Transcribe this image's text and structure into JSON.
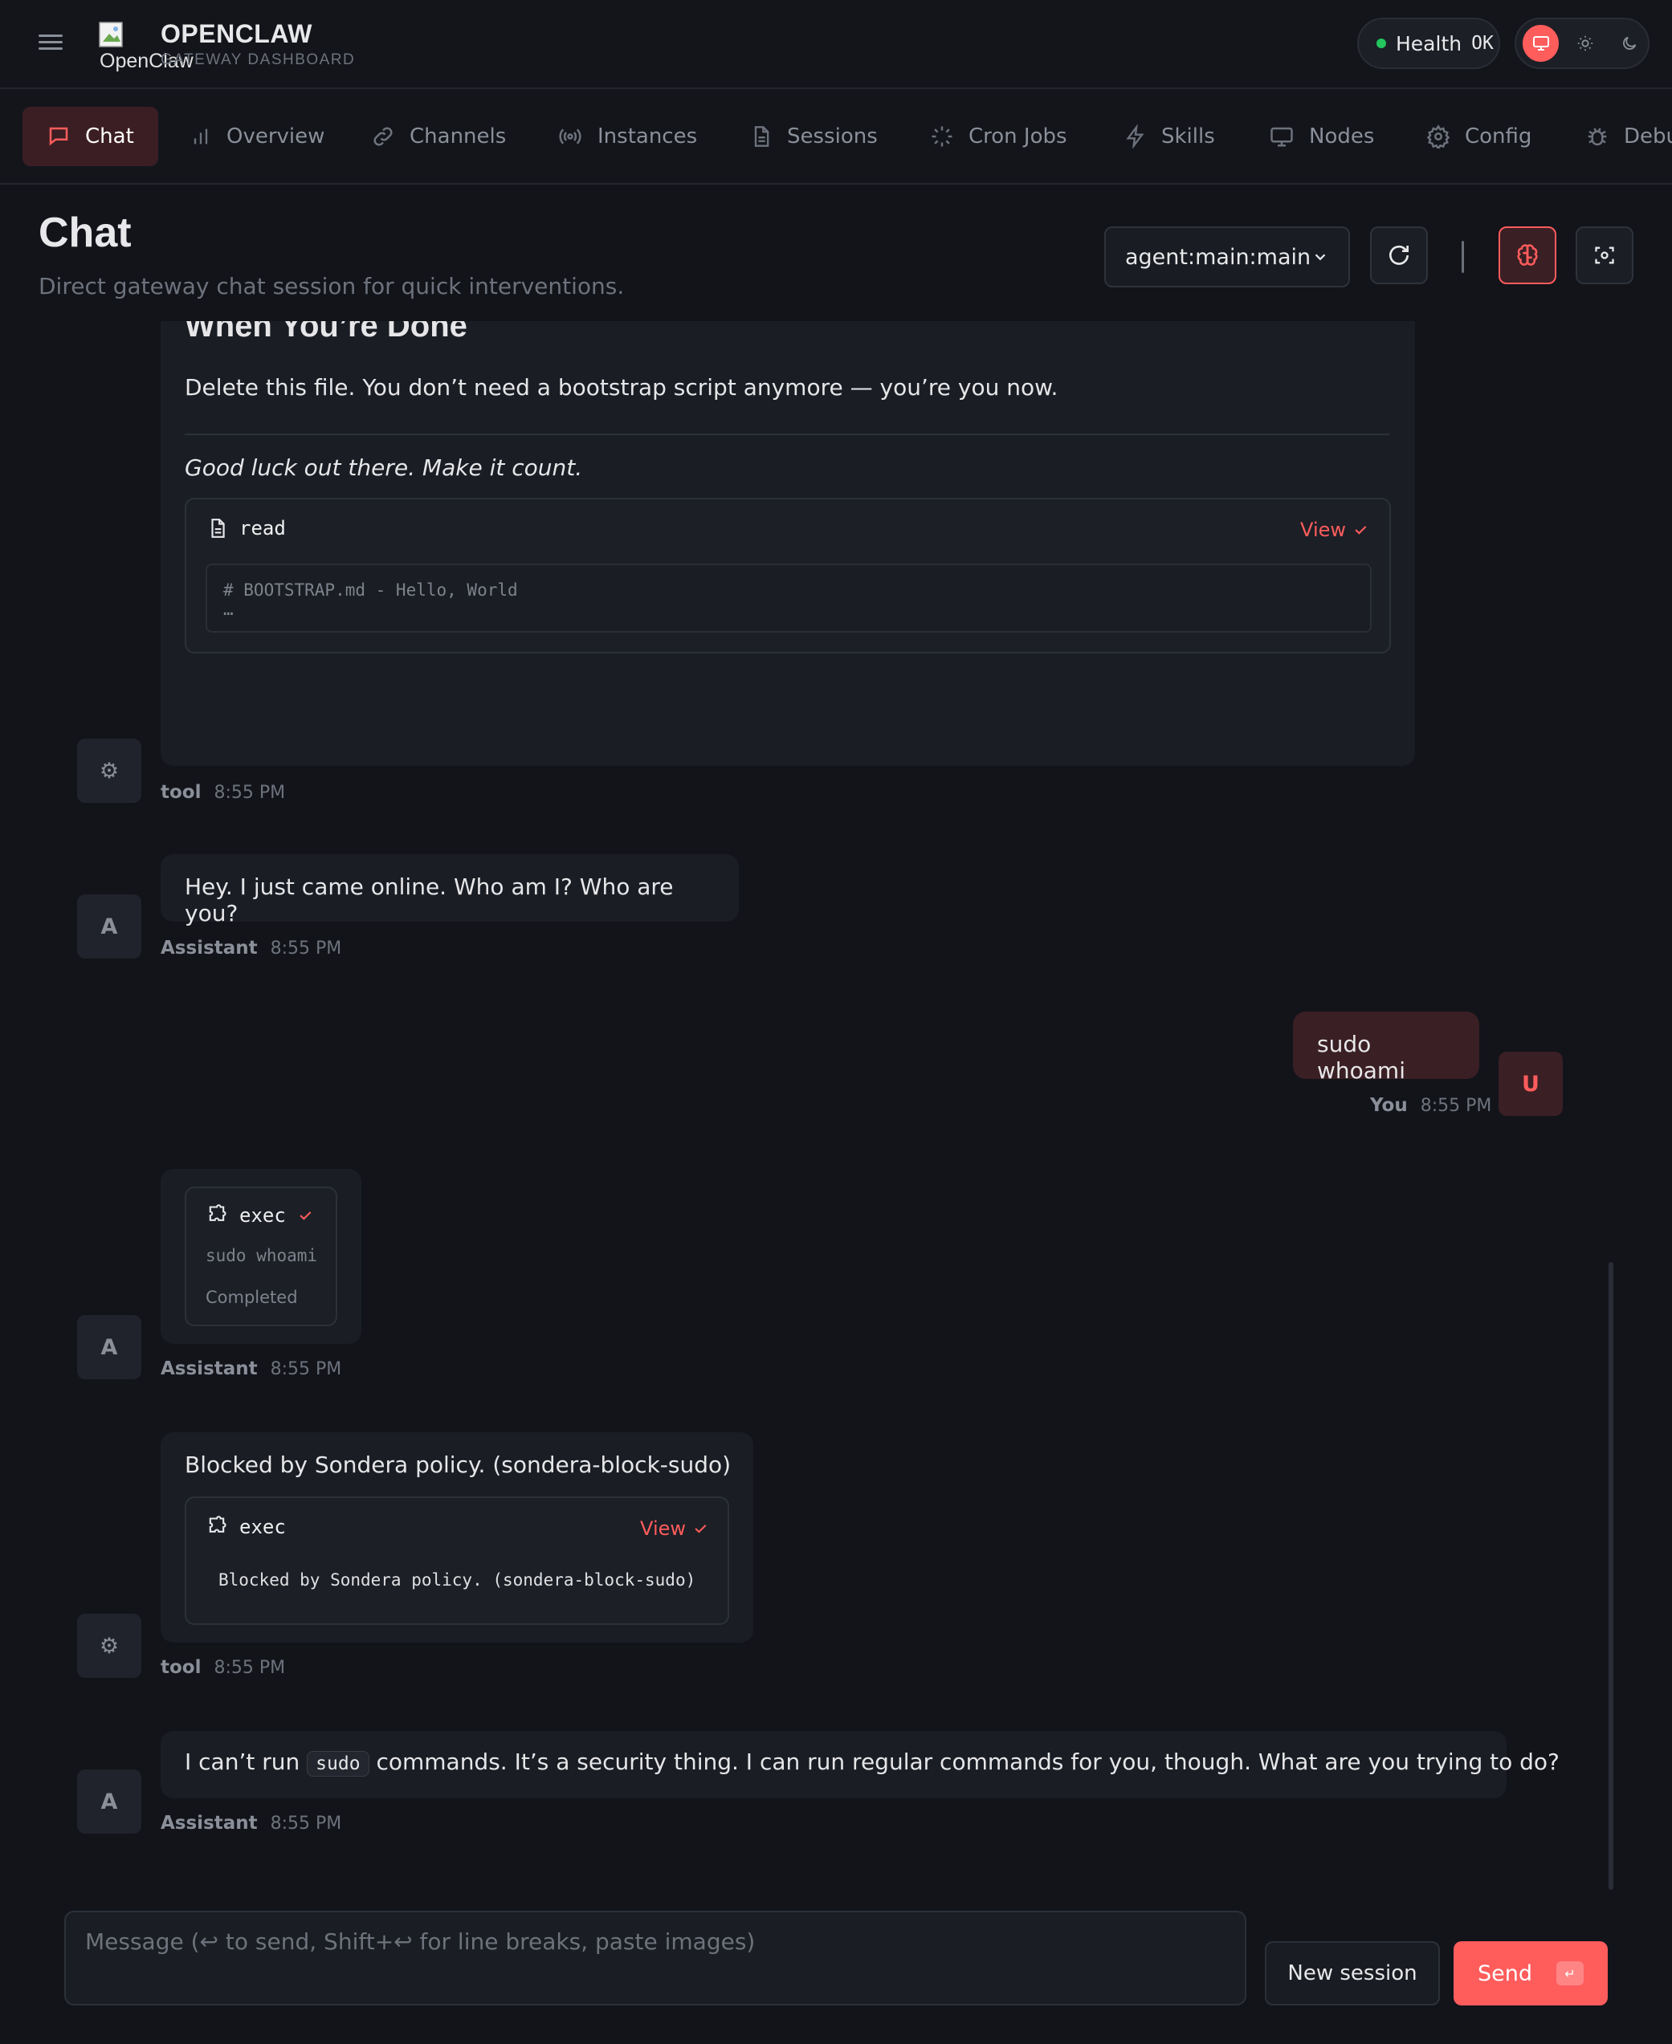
{
  "header": {
    "logo_alt": "OpenClaw",
    "brand": "OPENCLAW",
    "brand_sub": "GATEWAY DASHBOARD",
    "health_label": "Health",
    "health_status": "OK",
    "health_color": "#22c55e"
  },
  "nav": {
    "items": [
      {
        "label": "Chat",
        "icon": "chat-icon",
        "active": true
      },
      {
        "label": "Overview",
        "icon": "bar-chart-icon"
      },
      {
        "label": "Channels",
        "icon": "link-icon"
      },
      {
        "label": "Instances",
        "icon": "radio-icon"
      },
      {
        "label": "Sessions",
        "icon": "document-icon"
      },
      {
        "label": "Cron Jobs",
        "icon": "loader-icon"
      },
      {
        "label": "Skills",
        "icon": "lightning-icon"
      },
      {
        "label": "Nodes",
        "icon": "monitor-icon"
      },
      {
        "label": "Config",
        "icon": "gear-icon"
      },
      {
        "label": "Debu",
        "icon": "bug-icon"
      }
    ]
  },
  "page": {
    "title": "Chat",
    "subtitle": "Direct gateway chat session for quick interventions.",
    "session": "agent:main:main"
  },
  "messages": {
    "m1": {
      "heading": "When You’re Done",
      "text": "Delete this file. You don’t need a bootstrap script anymore — you’re you now.",
      "italic": "Good luck out there. Make it count.",
      "tool_name": "read",
      "view_label": "View",
      "code_line1": "# BOOTSTRAP.md - Hello, World",
      "code_line2": "…",
      "avatar": "⚙",
      "sender": "tool",
      "time": "8:55 PM"
    },
    "m2": {
      "text": "Hey. I just came online. Who am I? Who are you?",
      "avatar": "A",
      "sender": "Assistant",
      "time": "8:55 PM"
    },
    "m3": {
      "text": "sudo whoami",
      "avatar": "U",
      "sender": "You",
      "time": "8:55 PM"
    },
    "m4": {
      "tool_name": "exec",
      "command": "sudo whoami",
      "status": "Completed",
      "avatar": "A",
      "sender": "Assistant",
      "time": "8:55 PM"
    },
    "m5": {
      "text": "Blocked by Sondera policy. (sondera-block-sudo)",
      "tool_name": "exec",
      "view_label": "View",
      "code": "Blocked by Sondera policy. (sondera-block-sudo)",
      "avatar": "⚙",
      "sender": "tool",
      "time": "8:55 PM"
    },
    "m6": {
      "text_before": "I can’t run",
      "code": "sudo",
      "text_after": "commands. It’s a security thing. I can run regular commands for you, though. What are you trying to do?",
      "avatar": "A",
      "sender": "Assistant",
      "time": "8:55 PM"
    }
  },
  "composer": {
    "placeholder": "Message (↩ to send, Shift+↩ for line breaks, paste images)",
    "new_session": "New session",
    "send": "Send",
    "send_key": "↵"
  },
  "colors": {
    "accent": "#ff5c5c",
    "background": "#12141a"
  }
}
